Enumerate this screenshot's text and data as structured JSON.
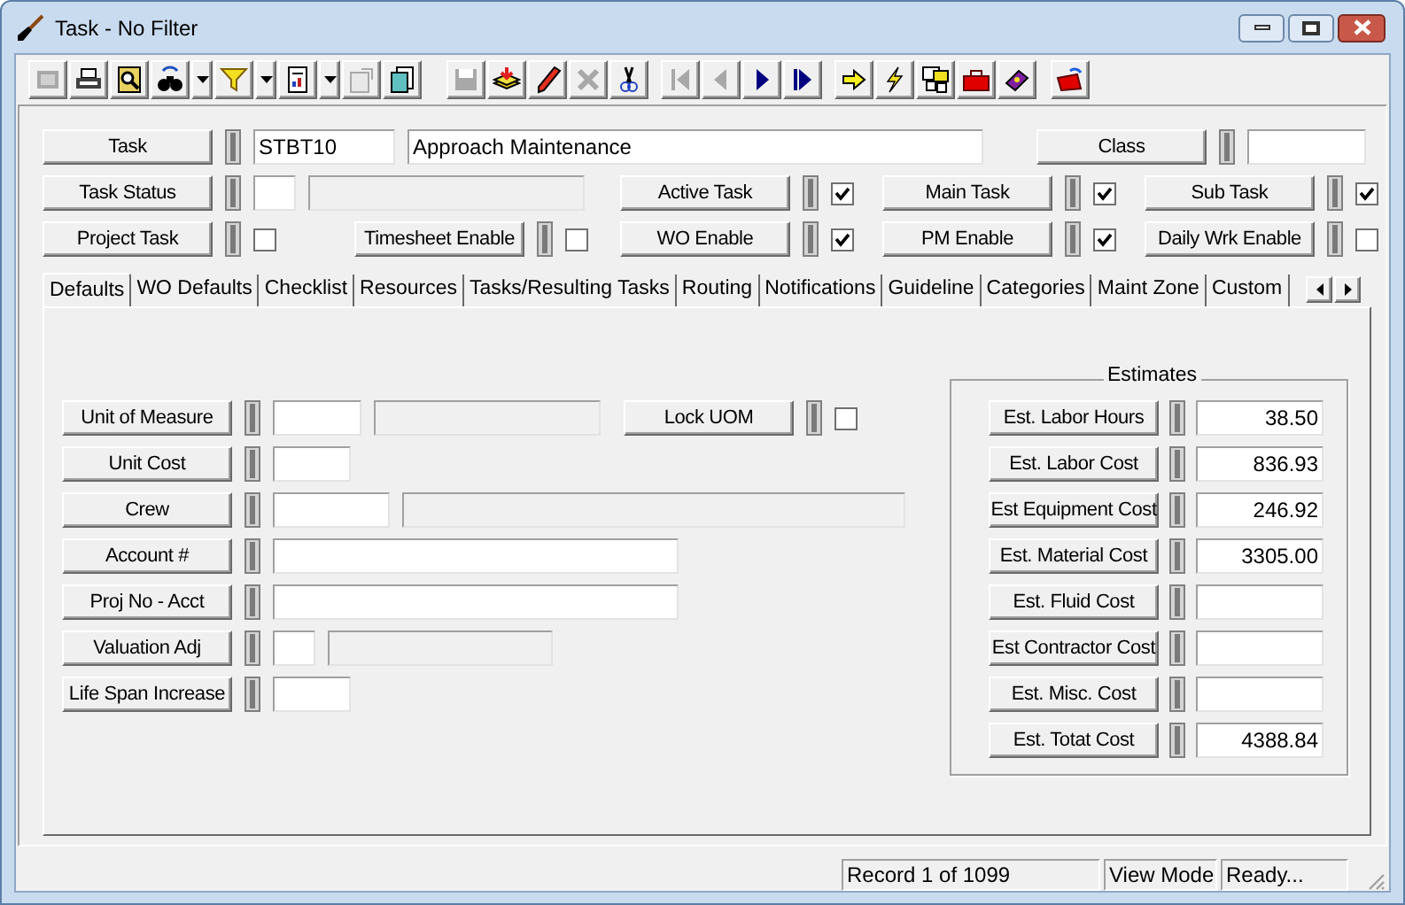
{
  "window": {
    "title": "Task - No Filter"
  },
  "toolbar": {
    "groups": [
      [
        {
          "kind": "button",
          "disabled": true
        },
        {
          "kind": "button",
          "disabled": false
        },
        {
          "kind": "button",
          "disabled": false
        },
        {
          "kind": "button",
          "disabled": false
        },
        {
          "kind": "dropdown",
          "disabled": false
        },
        {
          "kind": "button",
          "disabled": false
        },
        {
          "kind": "dropdown",
          "disabled": false
        },
        {
          "kind": "button",
          "disabled": false
        },
        {
          "kind": "dropdown",
          "disabled": false
        },
        {
          "kind": "button",
          "disabled": true
        },
        {
          "kind": "button",
          "disabled": false
        }
      ],
      [
        {
          "kind": "button",
          "disabled": true
        },
        {
          "kind": "button",
          "disabled": false
        },
        {
          "kind": "button",
          "disabled": false
        },
        {
          "kind": "button",
          "disabled": true
        },
        {
          "kind": "button",
          "disabled": false
        }
      ],
      [
        {
          "kind": "button",
          "disabled": true
        },
        {
          "kind": "button",
          "disabled": true
        },
        {
          "kind": "button",
          "disabled": false
        },
        {
          "kind": "button",
          "disabled": false
        }
      ],
      [
        {
          "kind": "button",
          "disabled": false
        },
        {
          "kind": "button",
          "disabled": false
        },
        {
          "kind": "button",
          "disabled": false
        },
        {
          "kind": "button",
          "disabled": false
        },
        {
          "kind": "button",
          "disabled": false
        }
      ],
      [
        {
          "kind": "button",
          "disabled": false
        }
      ]
    ]
  },
  "header": {
    "rows": [
      [
        {
          "kind": "lookup",
          "label": "Task",
          "fields": [
            {
              "value": "STBT10",
              "disabled": false
            },
            {
              "value": "Approach Maintenance",
              "disabled": false
            }
          ]
        },
        {
          "kind": "lookup",
          "label": "Class",
          "fields": [
            {
              "disabled": false
            }
          ]
        }
      ],
      [
        {
          "kind": "lookup",
          "label": "Task Status",
          "fields": [
            {
              "disabled": false
            },
            {
              "disabled": true
            }
          ]
        },
        {
          "kind": "empty"
        },
        {
          "kind": "check",
          "label": "Active Task",
          "checked": true
        },
        {
          "kind": "check",
          "label": "Main Task",
          "checked": true
        },
        {
          "kind": "check",
          "label": "Sub Task",
          "checked": true
        }
      ],
      [
        {
          "kind": "check",
          "label": "Project Task",
          "checked": false
        },
        {
          "kind": "check",
          "label": "Timesheet Enable",
          "checked": false
        },
        {
          "kind": "check",
          "label": "WO Enable",
          "checked": true
        },
        {
          "kind": "check",
          "label": "PM Enable",
          "checked": true
        },
        {
          "kind": "check",
          "label": "Daily Wrk Enable",
          "checked": false
        }
      ]
    ]
  },
  "tabs": [
    {
      "label": "Defaults",
      "selected": true
    },
    {
      "label": "WO Defaults",
      "selected": false
    },
    {
      "label": "Checklist",
      "selected": false
    },
    {
      "label": "Resources",
      "selected": false
    },
    {
      "label": "Tasks/Resulting Tasks",
      "selected": false
    },
    {
      "label": "Routing",
      "selected": false
    },
    {
      "label": "Notifications",
      "selected": false
    },
    {
      "label": "Guideline",
      "selected": false
    },
    {
      "label": "Categories",
      "selected": false
    },
    {
      "label": "Maint Zone",
      "selected": false
    },
    {
      "label": "Custom",
      "selected": false
    }
  ],
  "defaults": {
    "rows": [
      [
        {
          "kind": "lookup",
          "label": "Unit of Measure",
          "fields": [
            {
              "disabled": false
            },
            {
              "disabled": true
            }
          ]
        },
        {
          "kind": "check",
          "label": "Lock UOM",
          "checked": false
        }
      ],
      [
        {
          "kind": "lookup",
          "label": "Unit Cost",
          "fields": [
            {
              "disabled": false
            }
          ]
        }
      ],
      [
        {
          "kind": "lookup",
          "label": "Crew",
          "fields": [
            {
              "disabled": false
            },
            {
              "disabled": true
            }
          ]
        }
      ],
      [
        {
          "kind": "lookup",
          "label": "Account #",
          "fields": [
            {
              "disabled": false
            }
          ]
        }
      ],
      [
        {
          "kind": "lookup",
          "label": "Proj No - Acct",
          "fields": [
            {
              "disabled": false
            }
          ]
        }
      ],
      [
        {
          "kind": "lookup",
          "label": "Valuation Adj",
          "fields": [
            {
              "disabled": false
            },
            {
              "disabled": true
            }
          ]
        }
      ],
      [
        {
          "kind": "lookup",
          "label": "Life Span Increase",
          "fields": [
            {
              "disabled": false
            }
          ]
        }
      ]
    ],
    "estimates": {
      "title": "Estimates",
      "rows": [
        {
          "label": "Est. Labor Hours",
          "value": "38.50"
        },
        {
          "label": "Est. Labor Cost",
          "value": "836.93"
        },
        {
          "label": "Est Equipment Cost",
          "value": "246.92"
        },
        {
          "label": "Est. Material Cost",
          "value": "3305.00"
        },
        {
          "label": "Est. Fluid Cost"
        },
        {
          "label": "Est Contractor Cost"
        },
        {
          "label": "Est. Misc. Cost"
        },
        {
          "label": "Est. Totat Cost",
          "value": "4388.84"
        }
      ]
    }
  },
  "status_bar": {
    "panels": [
      "Record 1 of 1099",
      "View Mode",
      "Ready..."
    ]
  }
}
